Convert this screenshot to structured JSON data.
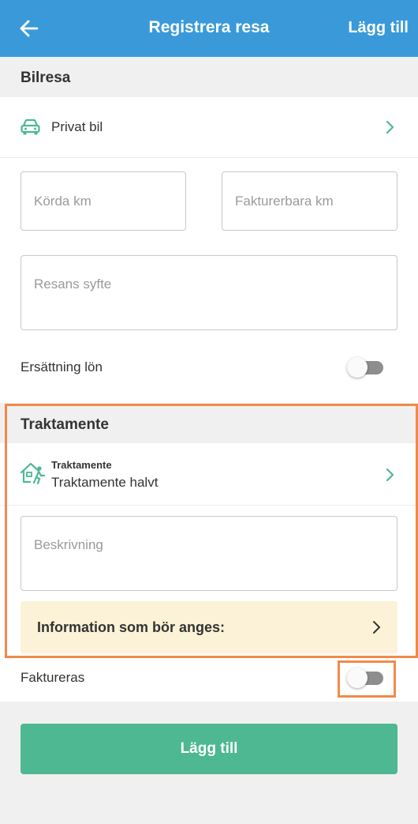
{
  "header": {
    "title": "Registrera resa",
    "add_label": "Lägg till",
    "back_icon": "arrow-left-icon"
  },
  "bilresa": {
    "section_title": "Bilresa",
    "vehicle_label": "Privat bil",
    "km_driven_placeholder": "Körda km",
    "km_billable_placeholder": "Fakturerbara km",
    "purpose_placeholder": "Resans syfte",
    "salary_comp_label": "Ersättning lön",
    "salary_comp_on": false
  },
  "traktamente": {
    "section_title": "Traktamente",
    "type_caption": "Traktamente",
    "type_value": "Traktamente halvt",
    "description_placeholder": "Beskrivning",
    "info_label": "Information som bör anges:"
  },
  "faktureras": {
    "label": "Faktureras",
    "on": false
  },
  "footer": {
    "submit_label": "Lägg till"
  },
  "colors": {
    "header": "#3a9ad9",
    "accent_green": "#4db891",
    "highlight": "#f08a4b",
    "info_bg": "#fbf2d7"
  }
}
